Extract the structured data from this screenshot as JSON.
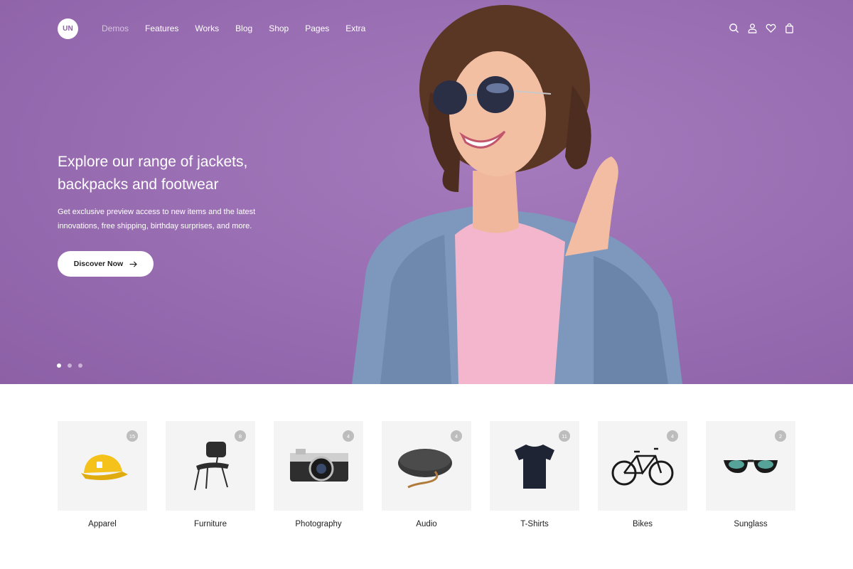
{
  "brand": {
    "logo_text": "UN"
  },
  "nav": {
    "items": [
      {
        "label": "Demos",
        "muted": true
      },
      {
        "label": "Features"
      },
      {
        "label": "Works"
      },
      {
        "label": "Blog"
      },
      {
        "label": "Shop"
      },
      {
        "label": "Pages"
      },
      {
        "label": "Extra"
      }
    ]
  },
  "header_icons": [
    "search-icon",
    "user-icon",
    "heart-icon",
    "bag-icon"
  ],
  "hero": {
    "title": "Explore our range of jackets, backpacks and footwear",
    "subtitle": "Get exclusive preview access to new items and the latest innovations, free shipping, birthday surprises, and more.",
    "cta_label": "Discover Now",
    "slide_count": 3,
    "active_slide": 1,
    "background_color": "#9a6fb3"
  },
  "categories": [
    {
      "label": "Apparel",
      "count": "15",
      "icon": "cap-icon"
    },
    {
      "label": "Furniture",
      "count": "8",
      "icon": "chair-icon"
    },
    {
      "label": "Photography",
      "count": "4",
      "icon": "camera-icon"
    },
    {
      "label": "Audio",
      "count": "4",
      "icon": "speaker-icon"
    },
    {
      "label": "T-Shirts",
      "count": "11",
      "icon": "tshirt-icon"
    },
    {
      "label": "Bikes",
      "count": "4",
      "icon": "bike-icon"
    },
    {
      "label": "Sunglass",
      "count": "2",
      "icon": "sunglasses-icon"
    }
  ]
}
